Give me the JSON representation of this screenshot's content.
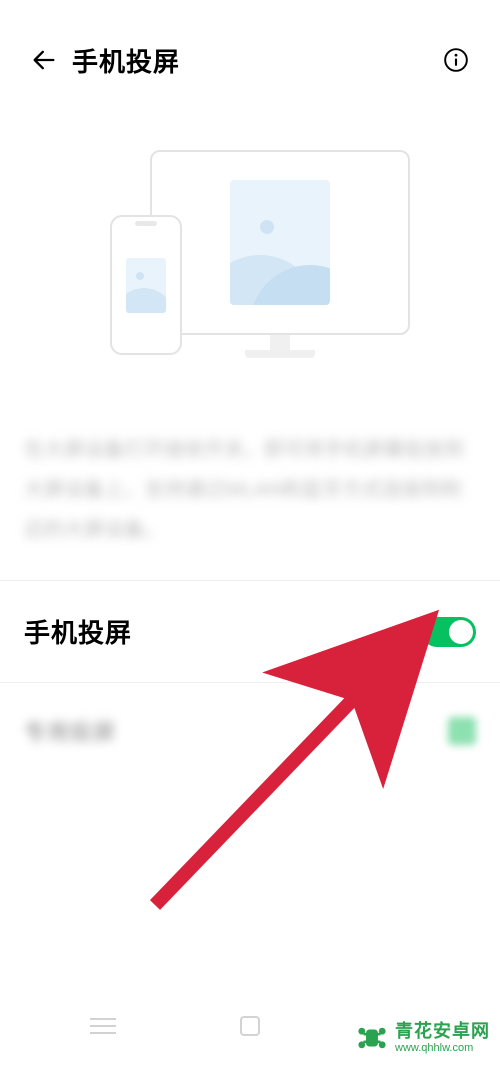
{
  "header": {
    "title": "手机投屏"
  },
  "description_placeholder": "在大屏设备打开接收开关，即可将手机屏幕投放到大屏设备上，支持通过WLAN和蓝牙方式连接到附近的大屏设备。",
  "settings": {
    "screen_mirror": {
      "label": "手机投屏",
      "enabled": true
    },
    "secondary": {
      "label": "专用投屏",
      "checked": true
    }
  },
  "watermark": {
    "site_name": "青花安卓网",
    "site_url": "www.qhhlw.com"
  },
  "colors": {
    "accent": "#07c160",
    "arrow": "#d8213b"
  }
}
